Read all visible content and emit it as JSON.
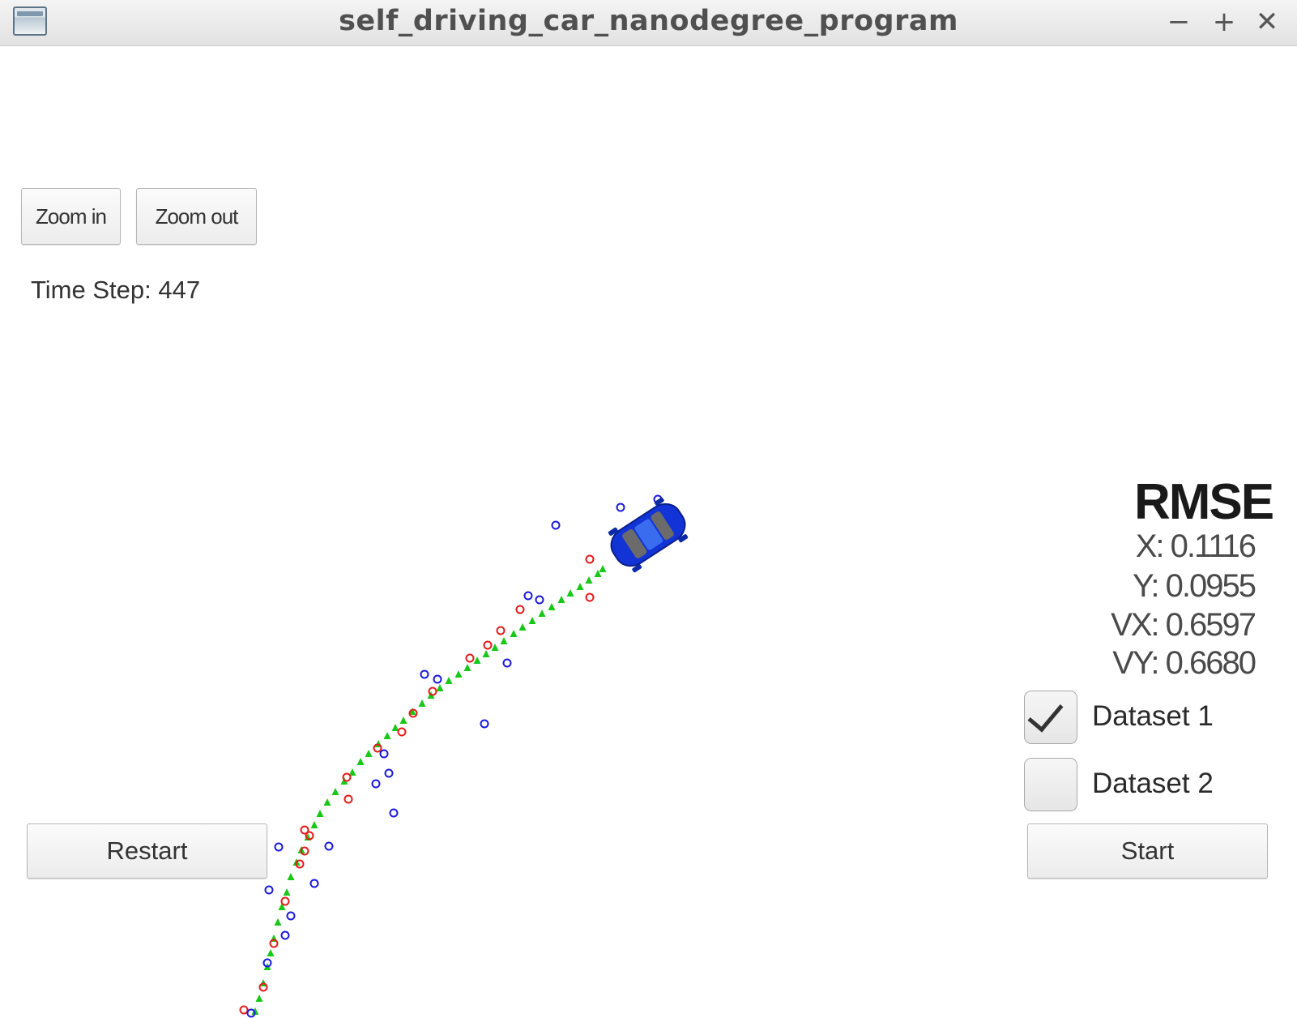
{
  "window": {
    "title": "self_driving_car_nanodegree_program",
    "icons": {
      "app": "window-app-icon",
      "minimize": "minimize-icon",
      "maximize": "maximize-icon",
      "close": "close-icon"
    },
    "controls": {
      "minimize": "−",
      "maximize": "+",
      "close": "✕"
    }
  },
  "controls": {
    "zoom_in": "Zoom in",
    "zoom_out": "Zoom out",
    "restart": "Restart",
    "start": "Start"
  },
  "time_step": "Time Step: 447",
  "rmse": {
    "title": "RMSE",
    "x": "X: 0.1116",
    "y": "Y: 0.0955",
    "vx": "VX: 0.6597",
    "vy": "VY: 0.6680"
  },
  "datasets": [
    {
      "label": "Dataset 1",
      "checked": true
    },
    {
      "label": "Dataset 2",
      "checked": false
    }
  ],
  "markers": {
    "ground_truth": {
      "shape": "triangle",
      "color": "#18c818"
    },
    "lidar": {
      "shape": "circle",
      "color": "#e51b1b"
    },
    "radar": {
      "shape": "circle",
      "color": "#1a1adb"
    },
    "vehicle": {
      "icon": "car-icon",
      "color": "#1233d6"
    }
  }
}
